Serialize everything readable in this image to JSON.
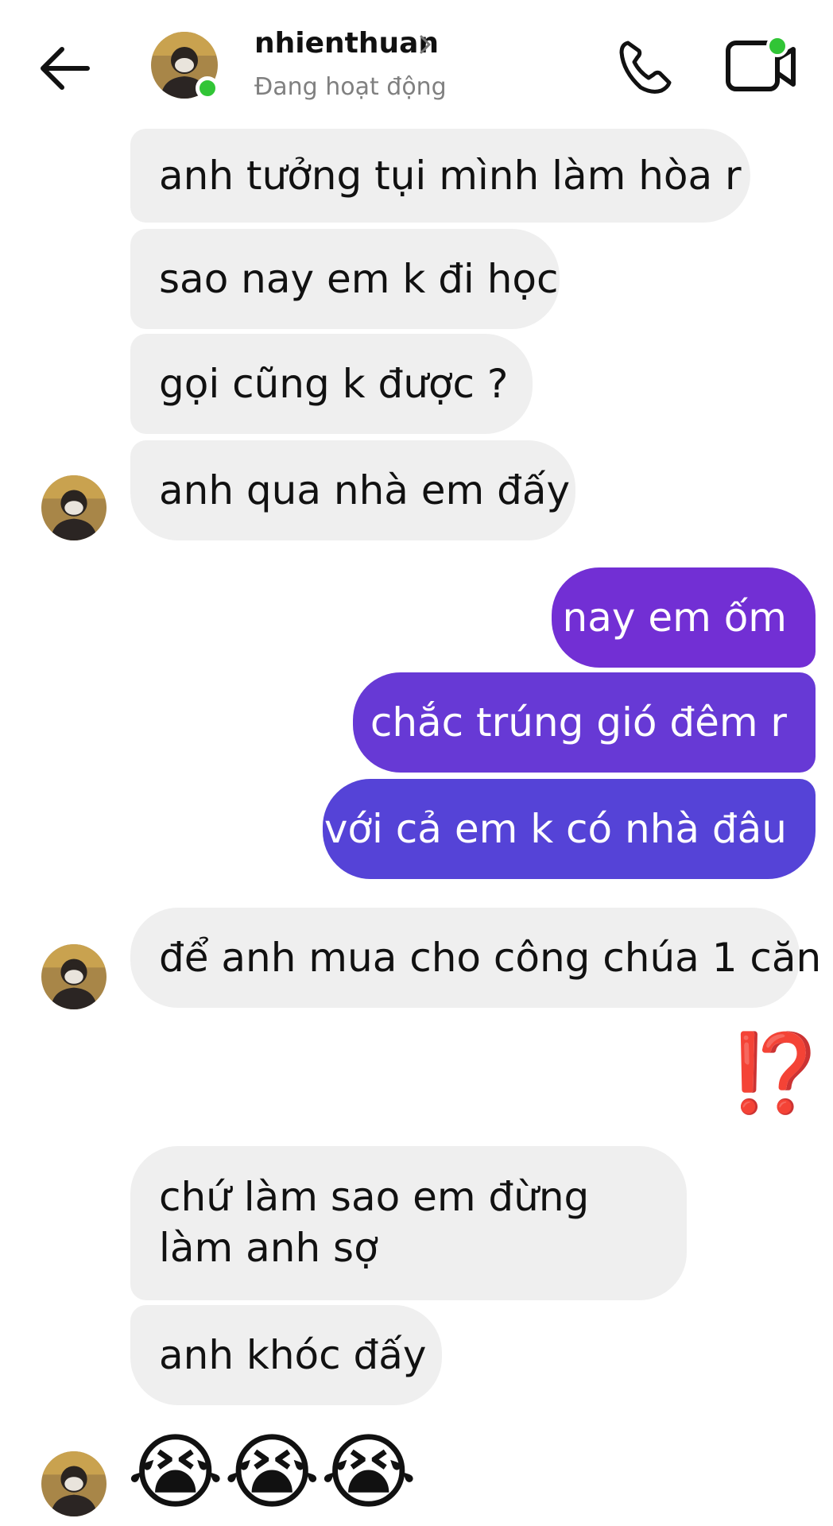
{
  "header": {
    "contact_name": "nhienthuan",
    "status": "Đang hoạt động",
    "icons": {
      "back": "arrow-left-icon",
      "chevron": "chevron-right-icon",
      "call": "phone-icon",
      "video": "video-camera-icon"
    }
  },
  "messages": [
    {
      "side": "in",
      "text": "anh tưởng tụi mình làm hòa r"
    },
    {
      "side": "in",
      "text": "sao nay em k đi học"
    },
    {
      "side": "in",
      "text": "gọi cũng k được ?"
    },
    {
      "side": "in",
      "text": "anh qua nhà em đấy"
    },
    {
      "side": "out",
      "text": "nay em ốm"
    },
    {
      "side": "out",
      "text": "chắc trúng gió đêm r"
    },
    {
      "side": "out",
      "text": "với cả em k có nhà đâu"
    },
    {
      "side": "in",
      "text": "để anh mua cho công chúa 1 căn"
    },
    {
      "side": "out",
      "text": "⁉️"
    },
    {
      "side": "in",
      "text": "chứ làm sao em đừng làm anh sợ"
    },
    {
      "side": "in",
      "text": "anh khóc đấy"
    },
    {
      "side": "in",
      "text": "😭😭😭"
    }
  ],
  "colors": {
    "incoming_bubble": "#efefef",
    "outgoing_gradient_top": "#7a2fd6",
    "outgoing_gradient_bottom": "#4a4fd8",
    "online": "#31c536",
    "status_text": "#808080"
  }
}
